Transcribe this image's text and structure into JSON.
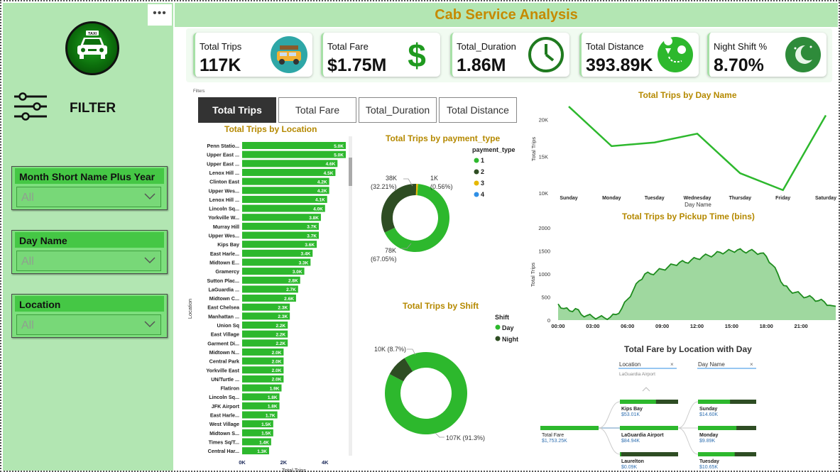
{
  "header": {
    "title": "Cab Service Analysis"
  },
  "sidebar": {
    "more": "•••",
    "filter_label": "FILTER",
    "logo_text": "TAXI",
    "slicers": [
      {
        "title": "Month Short Name Plus Year",
        "value": "All"
      },
      {
        "title": "Day Name",
        "value": "All"
      },
      {
        "title": "Location",
        "value": "All"
      }
    ]
  },
  "kpis": [
    {
      "title": "Total Trips",
      "value": "117K",
      "icon": "taxi-icon"
    },
    {
      "title": "Total Fare",
      "value": "$1.75M",
      "icon": "dollar-icon"
    },
    {
      "title": "Total_Duration",
      "value": "1.86M",
      "icon": "clock-icon"
    },
    {
      "title": "Total Distance",
      "value": "393.89K",
      "icon": "map-route-icon"
    },
    {
      "title": "Night Shift %",
      "value": "8.70%",
      "icon": "moon-icon"
    }
  ],
  "filters_caption": "Filters",
  "tabs": [
    {
      "label": "Total Trips",
      "active": true
    },
    {
      "label": "Total Fare",
      "active": false
    },
    {
      "label": "Total_Duration",
      "active": false
    },
    {
      "label": "Total Distance",
      "active": false
    }
  ],
  "colors": {
    "green": "#2db82d",
    "dark_green": "#2e4d23",
    "gold": "#b58900",
    "yellow": "#e6b800",
    "blue": "#2f8fe6",
    "area": "#9fd89f"
  },
  "chart_data": [
    {
      "type": "bar",
      "title": "Total Trips by Location",
      "ylabel": "Location",
      "xlabel": "Total Trips",
      "xticks": [
        "0K",
        "2K",
        "4K"
      ],
      "xlim": [
        0,
        5.0
      ],
      "categories": [
        "Penn Statio...",
        "Upper East ...",
        "Upper East ...",
        "Lenox Hill ...",
        "Clinton East",
        "Upper Wes...",
        "Lenox Hill ...",
        "Lincoln Sq...",
        "Yorkville W...",
        "Murray Hill",
        "Upper Wes...",
        "Kips Bay",
        "East Harle...",
        "Midtown E...",
        "Gramercy",
        "Sutton Plac...",
        "LaGuardia ...",
        "Midtown C...",
        "East Chelsea",
        "Manhattan ...",
        "Union Sq",
        "East Village",
        "Garment Di...",
        "Midtown N...",
        "Central Park",
        "Yorkville East",
        "UN/Turtle ...",
        "Flatiron",
        "Lincoln Sq...",
        "JFK Airport",
        "East Harle...",
        "West Village",
        "Midtown S...",
        "Times Sq/T...",
        "Central Har..."
      ],
      "values": [
        5.0,
        5.0,
        4.6,
        4.5,
        4.2,
        4.2,
        4.1,
        4.0,
        3.8,
        3.7,
        3.7,
        3.6,
        3.4,
        3.3,
        3.0,
        2.8,
        2.7,
        2.6,
        2.3,
        2.3,
        2.2,
        2.2,
        2.2,
        2.0,
        2.0,
        2.0,
        2.0,
        1.9,
        1.8,
        1.8,
        1.7,
        1.5,
        1.5,
        1.4,
        1.3
      ],
      "labels": [
        "5.0K",
        "5.0K",
        "4.6K",
        "4.5K",
        "4.2K",
        "4.2K",
        "4.1K",
        "4.0K",
        "3.8K",
        "3.7K",
        "3.7K",
        "3.6K",
        "3.4K",
        "3.3K",
        "3.0K",
        "2.8K",
        "2.7K",
        "2.6K",
        "2.3K",
        "2.3K",
        "2.2K",
        "2.2K",
        "2.2K",
        "2.0K",
        "2.0K",
        "2.0K",
        "2.0K",
        "1.9K",
        "1.8K",
        "1.8K",
        "1.7K",
        "1.5K",
        "1.5K",
        "1.4K",
        "1.3K"
      ]
    },
    {
      "type": "pie",
      "title": "Total Trips by payment_type",
      "legend_title": "payment_type",
      "categories": [
        "1",
        "2",
        "3",
        "4"
      ],
      "values": [
        78,
        38,
        1,
        0.02
      ],
      "labels": [
        "78K",
        "38K",
        "1K",
        ""
      ],
      "percent_labels": [
        "(67.05%)",
        "(32.21%)",
        "(0.56%)",
        ""
      ]
    },
    {
      "type": "pie",
      "title": "Total Trips by Shift",
      "legend_title": "Shift",
      "categories": [
        "Day",
        "Night"
      ],
      "values": [
        107,
        10
      ],
      "labels": [
        "107K (91.3%)",
        "10K (8.7%)"
      ]
    },
    {
      "type": "line",
      "title": "Total Trips by Day Name",
      "xlabel": "Day Name",
      "ylabel": "Total Trips",
      "categories": [
        "Sunday",
        "Monday",
        "Tuesday",
        "Wednesday",
        "Thursday",
        "Friday",
        "Saturday"
      ],
      "values": [
        21800,
        16400,
        16900,
        18100,
        12700,
        10400,
        20600
      ],
      "yticks": [
        "20K",
        "15K",
        "10K"
      ],
      "ylim": [
        10000,
        22000
      ]
    },
    {
      "type": "area",
      "title": "Total Trips by Pickup Time (bins)",
      "ylabel": "Total Trips",
      "xticks": [
        "00:00",
        "03:00",
        "06:00",
        "09:00",
        "12:00",
        "15:00",
        "18:00",
        "21:00"
      ],
      "yticks": [
        "0",
        "500",
        "1000",
        "1500",
        "2000"
      ],
      "ylim": [
        0,
        2000
      ],
      "x_hours": [
        0,
        0.5,
        1,
        1.5,
        2,
        2.5,
        3,
        3.5,
        4,
        4.5,
        5,
        5.5,
        6,
        6.5,
        7,
        7.5,
        8,
        8.5,
        9,
        9.5,
        10,
        10.5,
        11,
        11.5,
        12,
        12.5,
        13,
        13.5,
        14,
        14.5,
        15,
        15.5,
        16,
        16.5,
        17,
        17.5,
        18,
        18.5,
        19,
        19.5,
        20,
        20.5,
        21,
        21.5,
        22,
        22.5,
        23,
        23.5
      ],
      "values": [
        350,
        250,
        200,
        250,
        120,
        100,
        70,
        60,
        50,
        60,
        120,
        250,
        450,
        650,
        850,
        1000,
        1000,
        1050,
        1100,
        1150,
        1200,
        1250,
        1250,
        1300,
        1330,
        1380,
        1400,
        1420,
        1470,
        1480,
        1500,
        1520,
        1490,
        1500,
        1480,
        1450,
        1380,
        1200,
        1000,
        750,
        650,
        600,
        550,
        500,
        480,
        420,
        400,
        320
      ]
    },
    {
      "type": "table",
      "title": "Total Fare by Location with Day",
      "location_header": "Location",
      "location_value": "LaGuardia Airport",
      "day_header": "Day Name",
      "root": {
        "label": "Total Fare",
        "value": "$1,753.25K"
      },
      "locations": [
        {
          "label": "Kips Bay",
          "value": "$53.01K"
        },
        {
          "label": "LaGuardia Airport",
          "value": "$84.94K"
        },
        {
          "label": "Laurelton",
          "value": "$0.09K"
        }
      ],
      "days": [
        {
          "label": "Sunday",
          "value": "$14.60K"
        },
        {
          "label": "Monday",
          "value": "$9.89K"
        },
        {
          "label": "Tuesday",
          "value": "$10.65K"
        }
      ]
    }
  ]
}
